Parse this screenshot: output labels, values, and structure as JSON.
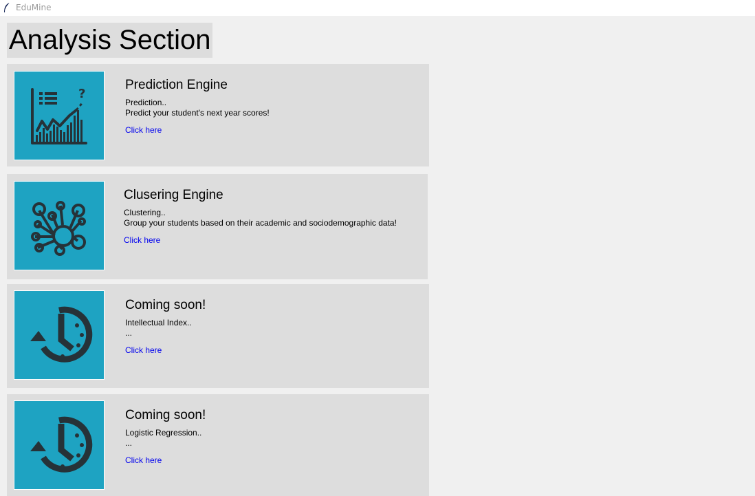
{
  "window": {
    "title": "EduMine"
  },
  "page": {
    "heading": "Analysis Section"
  },
  "cards": [
    {
      "title": "Prediction Engine",
      "subtitle": "Prediction..",
      "description": "Predict your student's next year scores!",
      "link": "Click here",
      "icon": "prediction-chart-icon"
    },
    {
      "title": "Clusering Engine",
      "subtitle": "Clustering..",
      "description": "Group your students based on their academic and sociodemographic data!",
      "link": "Click here",
      "icon": "cluster-network-icon"
    },
    {
      "title": "Coming soon!",
      "subtitle": "Intellectual Index..",
      "description": "...",
      "link": "Click here",
      "icon": "clock-history-icon"
    },
    {
      "title": "Coming soon!",
      "subtitle": "Logistic Regression..",
      "description": "...",
      "link": "Click here",
      "icon": "clock-history-icon"
    }
  ],
  "colors": {
    "background": "#f0f0f0",
    "card_background": "#dddddd",
    "thumbnail_background": "#1ea3c2",
    "icon_color": "#263238",
    "link_color": "#0000ee"
  }
}
